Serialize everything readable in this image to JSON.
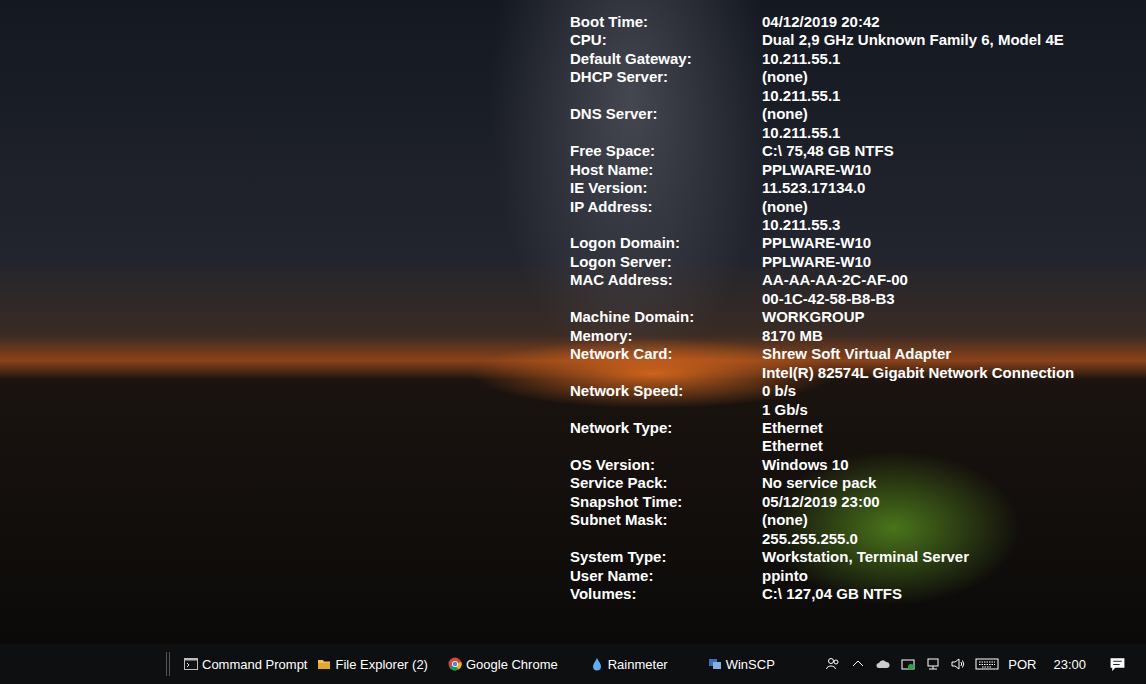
{
  "desktop": {
    "info": [
      {
        "label": "Boot Time:",
        "values": [
          "04/12/2019 20:42"
        ]
      },
      {
        "label": "CPU:",
        "values": [
          "Dual 2,9 GHz Unknown Family 6, Model 4E"
        ]
      },
      {
        "label": "Default Gateway:",
        "values": [
          "10.211.55.1"
        ]
      },
      {
        "label": "DHCP Server:",
        "values": [
          "(none)",
          "10.211.55.1"
        ]
      },
      {
        "label": "DNS Server:",
        "values": [
          "(none)",
          "10.211.55.1"
        ]
      },
      {
        "label": "Free Space:",
        "values": [
          "C:\\ 75,48 GB NTFS"
        ]
      },
      {
        "label": "Host Name:",
        "values": [
          "PPLWARE-W10"
        ]
      },
      {
        "label": "IE Version:",
        "values": [
          "11.523.17134.0"
        ]
      },
      {
        "label": "IP Address:",
        "values": [
          "(none)",
          "10.211.55.3"
        ]
      },
      {
        "label": "Logon Domain:",
        "values": [
          "PPLWARE-W10"
        ]
      },
      {
        "label": "Logon Server:",
        "values": [
          "PPLWARE-W10"
        ]
      },
      {
        "label": "MAC Address:",
        "values": [
          "AA-AA-AA-2C-AF-00",
          "00-1C-42-58-B8-B3"
        ]
      },
      {
        "label": "Machine Domain:",
        "values": [
          "WORKGROUP"
        ]
      },
      {
        "label": "Memory:",
        "values": [
          "8170 MB"
        ]
      },
      {
        "label": "Network Card:",
        "values": [
          "Shrew Soft Virtual Adapter",
          "Intel(R) 82574L Gigabit Network Connection"
        ]
      },
      {
        "label": "Network Speed:",
        "values": [
          "0 b/s",
          "1 Gb/s"
        ]
      },
      {
        "label": "Network Type:",
        "values": [
          "Ethernet",
          "Ethernet"
        ]
      },
      {
        "label": "OS Version:",
        "values": [
          "Windows 10"
        ]
      },
      {
        "label": "Service Pack:",
        "values": [
          "No service pack"
        ]
      },
      {
        "label": "Snapshot Time:",
        "values": [
          "05/12/2019 23:00"
        ]
      },
      {
        "label": "Subnet Mask:",
        "values": [
          "(none)",
          "255.255.255.0"
        ]
      },
      {
        "label": "System Type:",
        "values": [
          "Workstation, Terminal Server"
        ]
      },
      {
        "label": "User Name:",
        "values": [
          "ppinto"
        ]
      },
      {
        "label": "Volumes:",
        "values": [
          "C:\\ 127,04 GB NTFS"
        ]
      }
    ]
  },
  "taskbar": {
    "apps": [
      {
        "label": "Command Prompt"
      },
      {
        "label": "File Explorer (2)"
      },
      {
        "label": "Google Chrome"
      },
      {
        "label": "Rainmeter"
      },
      {
        "label": "WinSCP"
      }
    ],
    "tray": {
      "language": "POR",
      "time": "23:00"
    }
  }
}
